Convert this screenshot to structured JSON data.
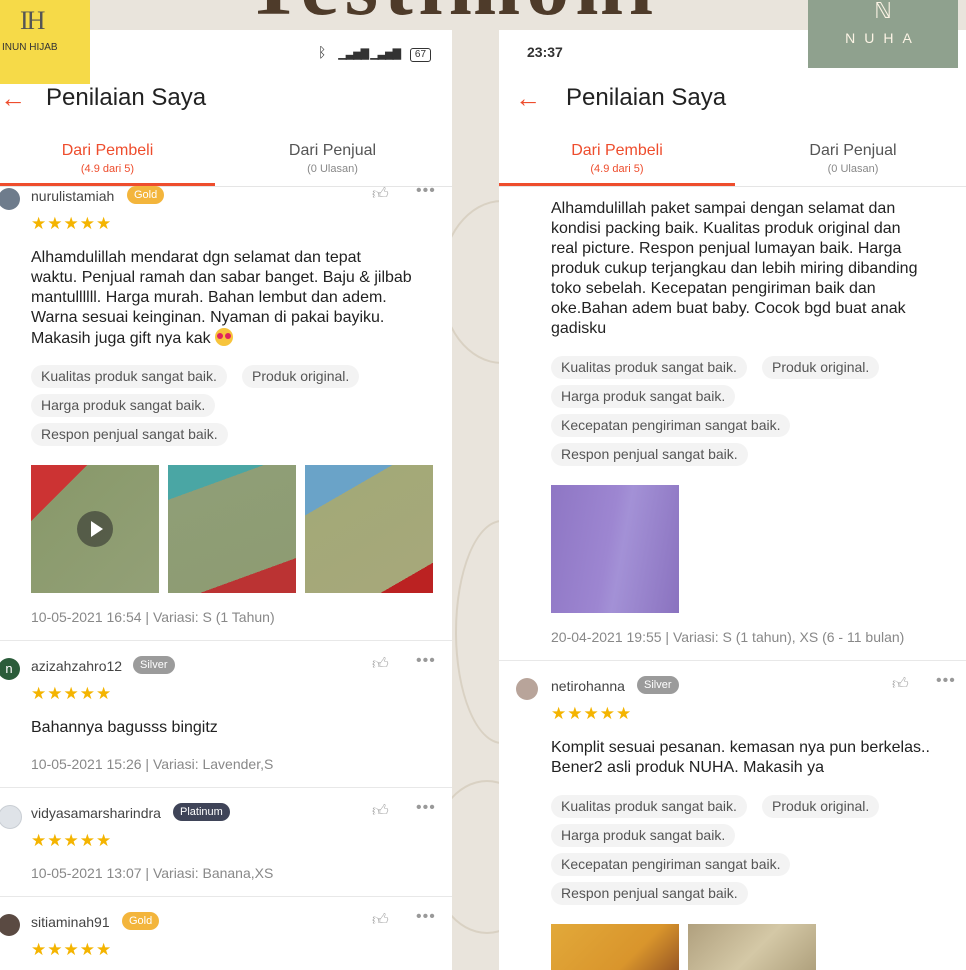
{
  "page": {
    "title": "Testimoni"
  },
  "brands": {
    "left": "INUN HIJAB",
    "right": "NUHA"
  },
  "left": {
    "status_battery": "67",
    "header": {
      "title": "Penilaian Saya"
    },
    "tabs": [
      {
        "label": "Dari Pembeli",
        "sub": "(4.9 dari 5)"
      },
      {
        "label": "Dari Penjual",
        "sub": "(0 Ulasan)"
      }
    ],
    "reviews": [
      {
        "user": "nurulistamiah",
        "badge": "Gold",
        "stars": "★★★★★",
        "lines": [
          "Alhamdulillah mendarat dgn selamat dan tepat",
          "waktu. Penjual ramah dan sabar banget. Baju & jilbab",
          "mantullllll. Harga murah. Bahan lembut dan adem.",
          "Warna sesuai keinginan. Nyaman di pakai bayiku.",
          "Makasih juga gift nya kak"
        ],
        "tags": [
          "Kualitas produk sangat baik.",
          "Produk original.",
          "Harga produk sangat baik.",
          "Respon penjual sangat baik."
        ],
        "meta": "10-05-2021 16:54 | Variasi: S   (1 Tahun)"
      },
      {
        "user": "azizahzahro12",
        "badge": "Silver",
        "stars": "★★★★★",
        "lines": [
          "Bahannya bagusss bingitz"
        ],
        "meta": "10-05-2021 15:26 | Variasi: Lavender,S"
      },
      {
        "user": "vidyasamarsharindra",
        "badge": "Platinum",
        "stars": "★★★★★",
        "meta": "10-05-2021 13:07 | Variasi: Banana,XS"
      },
      {
        "user": "sitiaminah91",
        "badge": "Gold",
        "stars": "★★★★★"
      }
    ]
  },
  "right": {
    "time": "23:37",
    "header": {
      "title": "Penilaian Saya"
    },
    "tabs": [
      {
        "label": "Dari Pembeli",
        "sub": "(4.9 dari 5)"
      },
      {
        "label": "Dari Penjual",
        "sub": "(0 Ulasan)"
      }
    ],
    "reviews": [
      {
        "lines": [
          "Alhamdulillah paket sampai dengan selamat dan",
          "kondisi packing baik. Kualitas produk original dan",
          "real picture. Respon penjual lumayan baik. Harga",
          "produk cukup terjangkau dan lebih miring dibanding",
          "toko sebelah. Kecepatan pengiriman baik dan",
          "oke.Bahan adem buat baby. Cocok bgd buat anak",
          "gadisku"
        ],
        "tags": [
          "Kualitas produk sangat baik.",
          "Produk original.",
          "Harga produk sangat baik.",
          "Kecepatan pengiriman sangat baik.",
          "Respon penjual sangat baik."
        ],
        "meta": "20-04-2021 19:55 | Variasi: S   (1 tahun), XS  (6 - 11 bulan)"
      },
      {
        "user": "netirohanna",
        "badge": "Silver",
        "stars": "★★★★★",
        "lines": [
          "Komplit sesuai pesanan. kemasan nya pun berkelas..",
          "Bener2 asli produk NUHA. Makasih ya"
        ],
        "tags": [
          "Kualitas produk sangat baik.",
          "Produk original.",
          "Harga produk sangat baik.",
          "Kecepatan pengiriman sangat baik.",
          "Respon penjual sangat baik."
        ]
      }
    ]
  },
  "icons": {
    "back": "back-arrow-icon",
    "like": "thumbs-up-icon",
    "more": "more-dots-icon",
    "star": "star-icon",
    "play": "play-icon"
  },
  "colors": {
    "accent": "#ee4d2d",
    "star": "#f4b400",
    "gold": "#f3b53c",
    "silver": "#9b9b9b",
    "platinum": "#3f4458"
  }
}
